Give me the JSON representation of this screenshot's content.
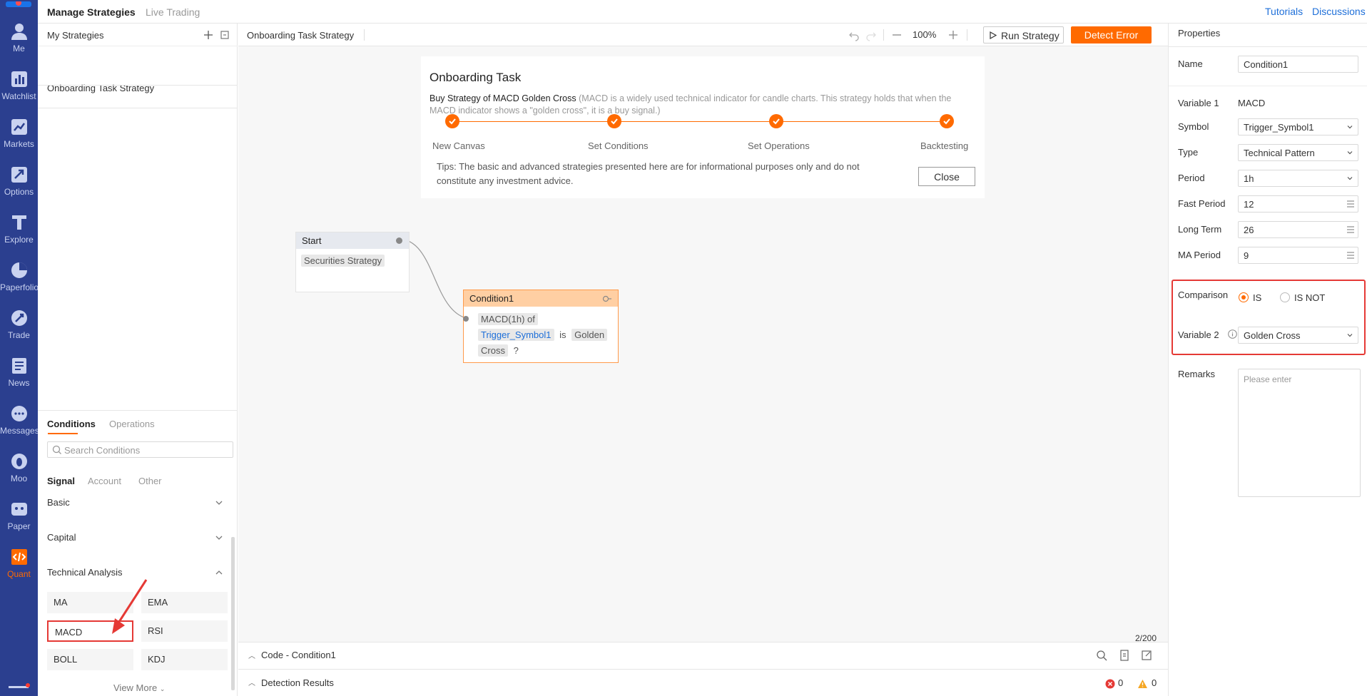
{
  "nav": {
    "items": [
      {
        "label": "Me",
        "icon": "person-icon"
      },
      {
        "label": "Watchlist",
        "icon": "bar-chart-icon"
      },
      {
        "label": "Markets",
        "icon": "trend-icon"
      },
      {
        "label": "Options",
        "icon": "options-icon"
      },
      {
        "label": "Explore",
        "icon": "explore-icon"
      },
      {
        "label": "Paperfolio",
        "icon": "pie-icon"
      },
      {
        "label": "Trade",
        "icon": "trade-icon"
      },
      {
        "label": "News",
        "icon": "news-icon"
      },
      {
        "label": "Messages",
        "icon": "message-icon"
      },
      {
        "label": "Moo",
        "icon": "moo-icon"
      },
      {
        "label": "Paper",
        "icon": "paper-icon"
      },
      {
        "label": "Quant",
        "icon": "code-icon"
      }
    ]
  },
  "topbar": {
    "tab_manage": "Manage Strategies",
    "tab_live": "Live Trading",
    "tutorials": "Tutorials",
    "discussions": "Discussions"
  },
  "left": {
    "header": "My Strategies",
    "strategy_item": "Onboarding Task Strategy",
    "tab_conditions": "Conditions",
    "tab_operations": "Operations",
    "search_placeholder": "Search Conditions",
    "subtab_signal": "Signal",
    "subtab_account": "Account",
    "subtab_other": "Other",
    "group_basic": "Basic",
    "group_capital": "Capital",
    "group_ta": "Technical Analysis",
    "ta_items": [
      "MA",
      "EMA",
      "MACD",
      "RSI",
      "BOLL",
      "KDJ"
    ],
    "view_more": "View More"
  },
  "toolbar": {
    "title": "Onboarding Task Strategy",
    "zoom": "100%",
    "run": "Run Strategy",
    "detect": "Detect Error"
  },
  "onboarding": {
    "title": "Onboarding Task",
    "subtitle": "Buy Strategy of MACD Golden Cross",
    "desc": "(MACD is a widely used technical indicator for candle charts. This strategy holds that when the MACD indicator shows a \"golden cross\", it is a buy signal.)",
    "steps": [
      "New Canvas",
      "Set Conditions",
      "Set Operations",
      "Backtesting"
    ],
    "tips": "Tips: The basic and advanced strategies presented here are for informational purposes only and do not constitute any investment advice.",
    "close": "Close"
  },
  "canvas": {
    "start_title": "Start",
    "start_chip": "Securities Strategy",
    "cond_title": "Condition1",
    "cond_part1": "MACD(1h) of",
    "cond_symbol": "Trigger_Symbol1",
    "cond_is": "is",
    "cond_golden": "Golden",
    "cond_cross": "Cross",
    "cond_q": "?",
    "count": "2/200"
  },
  "bottom": {
    "code": "Code - Condition1",
    "detection": "Detection Results",
    "errors": "0",
    "warnings": "0"
  },
  "props": {
    "header": "Properties",
    "name_label": "Name",
    "name_value": "Condition1",
    "var1_label": "Variable 1",
    "var1_value": "MACD",
    "symbol_label": "Symbol",
    "symbol_value": "Trigger_Symbol1",
    "type_label": "Type",
    "type_value": "Technical Pattern",
    "period_label": "Period",
    "period_value": "1h",
    "fast_label": "Fast Period",
    "fast_value": "12",
    "long_label": "Long Term",
    "long_value": "26",
    "ma_label": "MA Period",
    "ma_value": "9",
    "comparison_label": "Comparison",
    "is": "IS",
    "is_not": "IS NOT",
    "var2_label": "Variable 2",
    "var2_value": "Golden Cross",
    "remarks_label": "Remarks",
    "remarks_placeholder": "Please enter"
  },
  "colors": {
    "accent": "#ff6a00",
    "nav_bg": "#2b3f8f",
    "highlight_red": "#e53935",
    "link_blue": "#1e6fd9"
  }
}
